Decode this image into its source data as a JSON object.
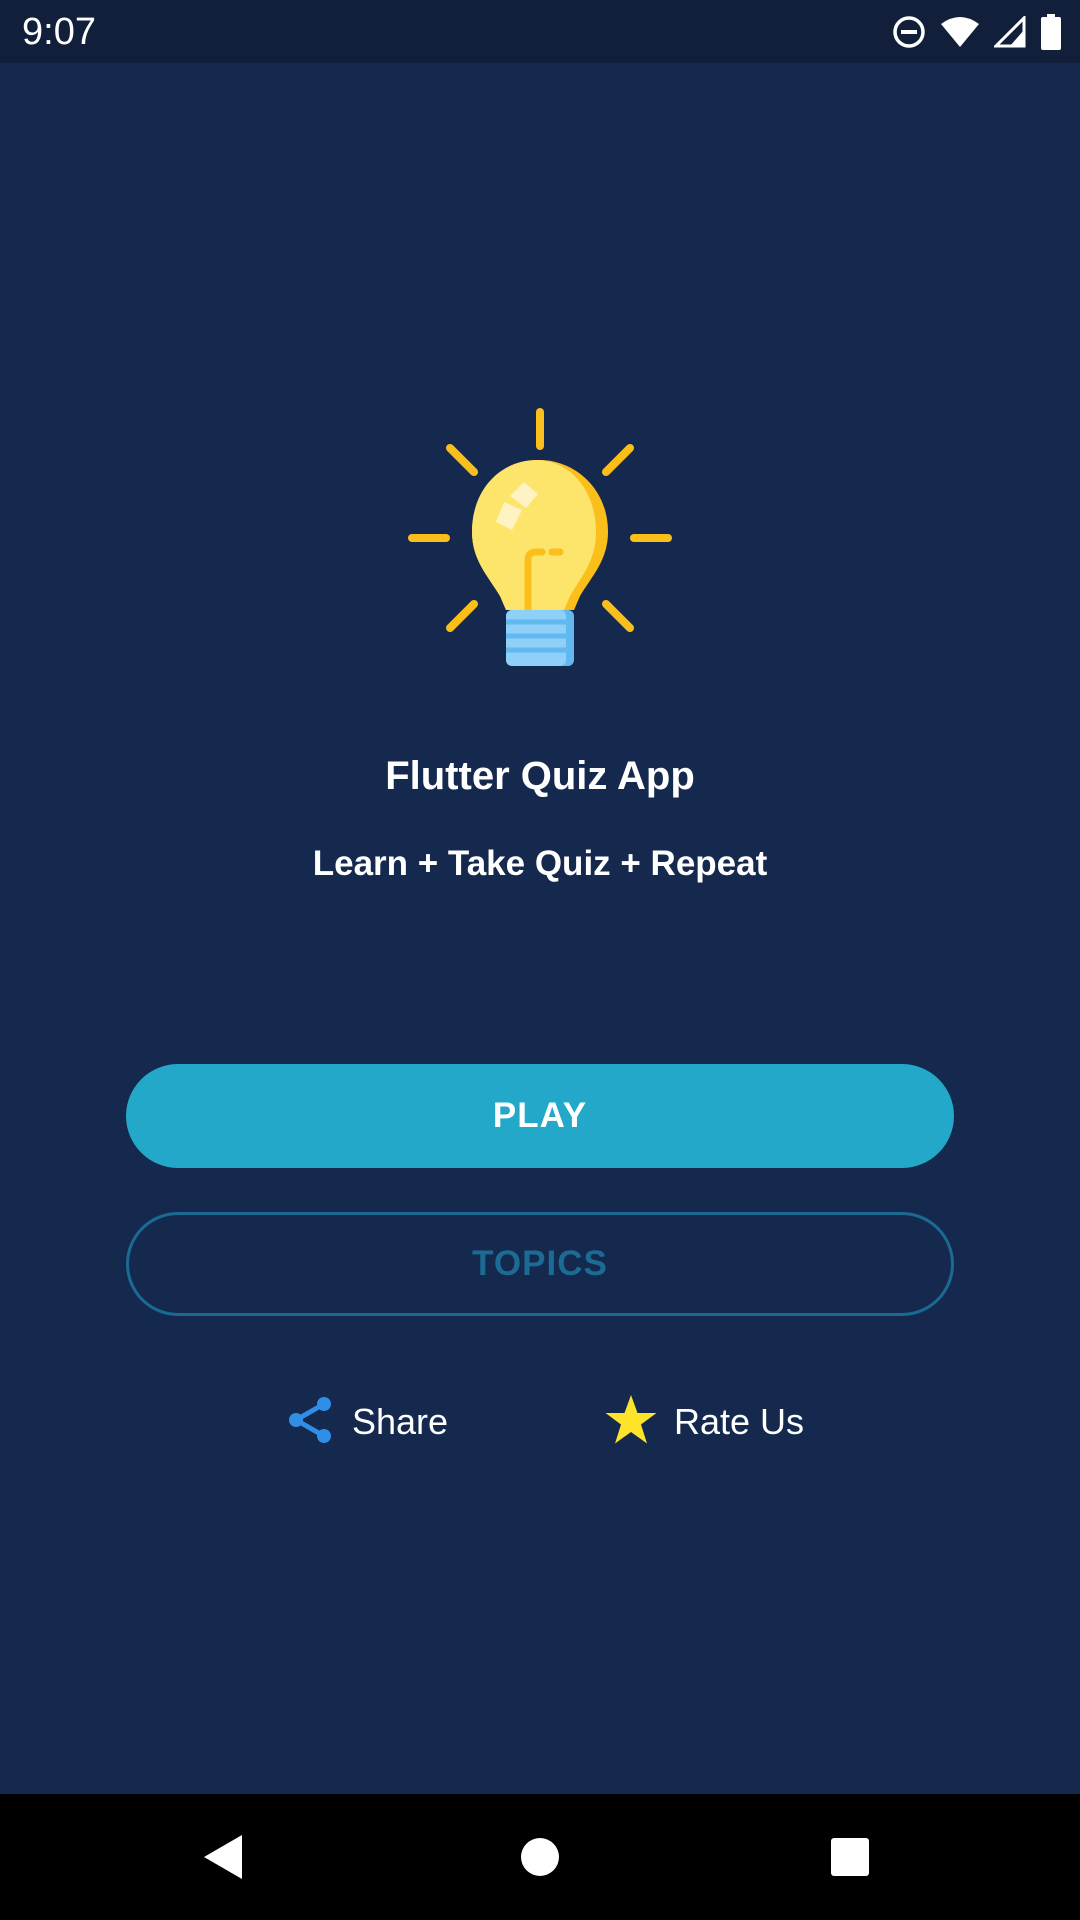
{
  "status_bar": {
    "time": "9:07",
    "icons": [
      "do-not-disturb-icon",
      "wifi-icon",
      "signal-icon",
      "battery-icon"
    ]
  },
  "app": {
    "title": "Flutter Quiz App",
    "subtitle": "Learn + Take Quiz + Repeat",
    "logo_icon": "lightbulb-icon"
  },
  "buttons": {
    "play_label": "PLAY",
    "topics_label": "TOPICS"
  },
  "actions": {
    "share_label": "Share",
    "share_icon": "share-icon",
    "rate_label": "Rate Us",
    "rate_icon": "star-icon"
  },
  "nav_bar": {
    "icons": [
      "back-icon",
      "home-icon",
      "recent-apps-icon"
    ]
  },
  "colors": {
    "background": "#15294e",
    "status_bar": "#111f3b",
    "play_button": "#23a8c9",
    "topics_border": "#1b6a94",
    "share_icon": "#2f8fe6",
    "star_icon": "#fde42a",
    "bulb_yellow": "#fdd837"
  }
}
